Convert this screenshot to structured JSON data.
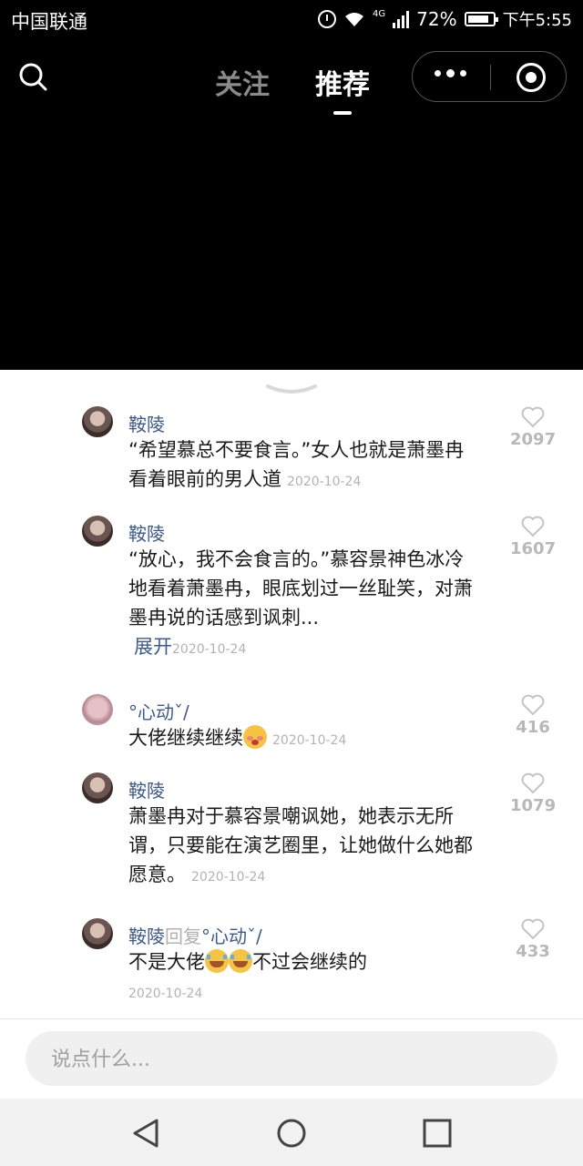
{
  "status": {
    "carrier": "中国联通",
    "network": "4G",
    "battery_pct": "72%",
    "time": "下午5:55"
  },
  "nav": {
    "tab_follow": "关注",
    "tab_recommend": "推荐",
    "active_tab": "推荐"
  },
  "comments": [
    {
      "user": "鞍陵",
      "text": "“希望慕总不要食言。”女人也就是萧墨冉看着眼前的男人道",
      "date": "2020-10-24",
      "likes": "2097"
    },
    {
      "user": "鞍陵",
      "text": "“放心，我不会食言的。”慕容景神色冰冷地看着萧墨冉，眼底划过一丝耻笑，对萧墨冉说的话感到讽刺...",
      "expand": "展开",
      "date": "2020-10-24",
      "likes": "1607"
    },
    {
      "user": "°心动ˇ/",
      "text": "大佬继续继续",
      "date": "2020-10-24",
      "likes": "416"
    },
    {
      "user": "鞍陵",
      "text": "萧墨冉对于慕容景嘲讽她，她表示无所谓，只要能在演艺圈里，让她做什么她都愿意。",
      "date": "2020-10-24",
      "likes": "1079"
    },
    {
      "user": "鞍陵",
      "reply_word": "回复",
      "reply_to": "°心动ˇ/",
      "text_before": "不是大佬",
      "text_after": "不过会继续的",
      "date": "2020-10-24",
      "likes": "433"
    }
  ],
  "input": {
    "placeholder": "说点什么..."
  },
  "icons": {
    "search": "search-icon",
    "more": "more-dots-icon",
    "close_miniprogram": "target-icon",
    "like": "heart-icon",
    "collapse": "chevron-down-icon",
    "nav_back": "triangle-back-icon",
    "nav_home": "circle-home-icon",
    "nav_recent": "square-recent-icon"
  }
}
